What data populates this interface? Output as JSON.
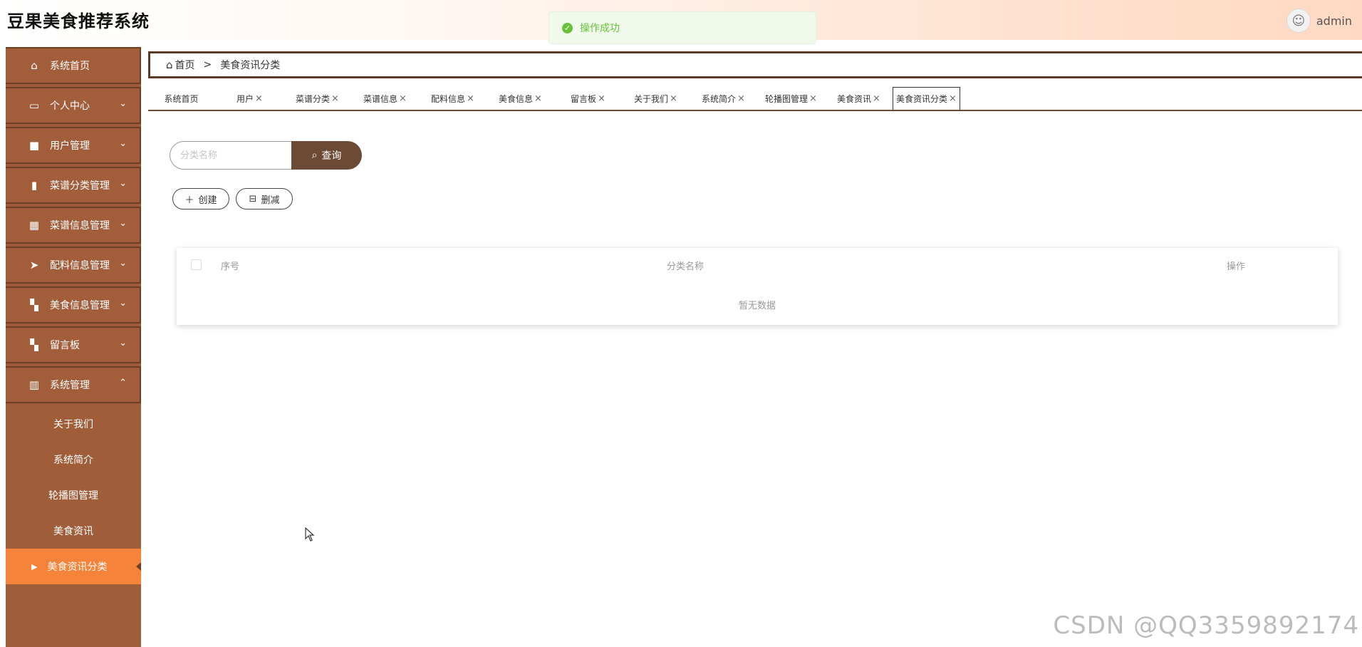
{
  "header": {
    "app_title": "豆果美食推荐系统",
    "username": "admin",
    "avatar_icon": "user-avatar-icon"
  },
  "toast": {
    "message": "操作成功",
    "color": "#67c23a"
  },
  "sidebar": {
    "items": [
      {
        "label": "系统首页",
        "icon": "home-icon",
        "chevron": ""
      },
      {
        "label": "个人中心",
        "icon": "card-icon",
        "chevron": "⌄"
      },
      {
        "label": "用户管理",
        "icon": "briefcase-icon",
        "chevron": "⌄"
      },
      {
        "label": "菜谱分类管理",
        "icon": "clipboard-icon",
        "chevron": "⌄"
      },
      {
        "label": "菜谱信息管理",
        "icon": "table-icon",
        "chevron": "⌄"
      },
      {
        "label": "配料信息管理",
        "icon": "send-icon",
        "chevron": "⌄"
      },
      {
        "label": "美食信息管理",
        "icon": "grid-icon",
        "chevron": "⌄"
      },
      {
        "label": "留言板",
        "icon": "grid-icon",
        "chevron": "⌄"
      },
      {
        "label": "系统管理",
        "icon": "bar-chart-icon",
        "chevron": "⌃"
      }
    ],
    "subitems": [
      {
        "label": "关于我们"
      },
      {
        "label": "系统简介"
      },
      {
        "label": "轮播图管理"
      },
      {
        "label": "美食资讯"
      },
      {
        "label": "美食资讯分类"
      }
    ],
    "active_color": "#f5843a",
    "bg_color": "#a05d39"
  },
  "breadcrumb": {
    "home": "首页",
    "separator": ">",
    "current": "美食资讯分类"
  },
  "tabs": [
    {
      "label": "系统首页",
      "close": ""
    },
    {
      "label": "用户",
      "close": "×"
    },
    {
      "label": "菜谱分类",
      "close": "×"
    },
    {
      "label": "菜谱信息",
      "close": "×"
    },
    {
      "label": "配料信息",
      "close": "×"
    },
    {
      "label": "美食信息",
      "close": "×"
    },
    {
      "label": "留言板",
      "close": "×"
    },
    {
      "label": "关于我们",
      "close": "×"
    },
    {
      "label": "系统简介",
      "close": "×"
    },
    {
      "label": "轮播图管理",
      "close": "×"
    },
    {
      "label": "美食资讯",
      "close": "×"
    },
    {
      "label": "美食资讯分类",
      "close": "×"
    }
  ],
  "search": {
    "placeholder": "分类名称",
    "value": "",
    "button_label": "查询"
  },
  "actions": {
    "create_label": "创建",
    "delete_label": "删减"
  },
  "table": {
    "columns": [
      "序号",
      "分类名称",
      "操作"
    ],
    "rows": [],
    "empty_text": "暂无数据"
  },
  "watermark": "CSDN @QQ3359892174"
}
